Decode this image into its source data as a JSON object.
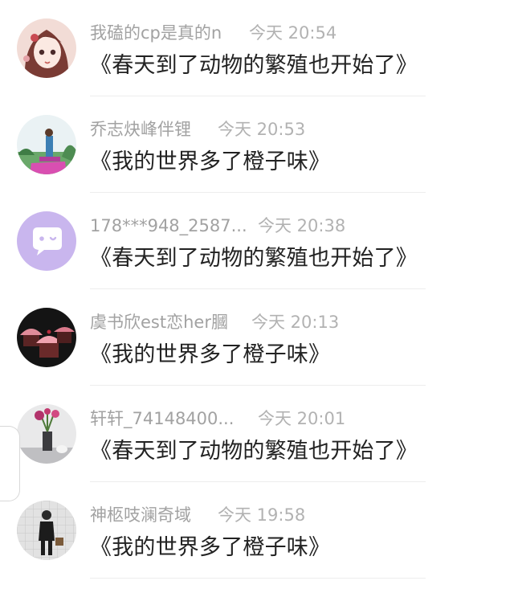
{
  "comments": [
    {
      "username": "我磕的cp是真的n",
      "time": "今天 20:54",
      "text": "《春天到了动物的繁殖也开始了》",
      "avatar_icon": "anime-girl-avatar"
    },
    {
      "username": "乔志炔峰伴锂",
      "time": "今天 20:53",
      "text": "《我的世界多了橙子味》",
      "avatar_icon": "outdoor-photo-avatar"
    },
    {
      "username": "178***948_2587...",
      "time": "今天 20:38",
      "text": "《春天到了动物的繁殖也开始了》",
      "avatar_icon": "default-chat-avatar"
    },
    {
      "username": "虞书欣est恋her膕",
      "time": "今天 20:13",
      "text": "《我的世界多了橙子味》",
      "avatar_icon": "cupcake-avatar"
    },
    {
      "username": "轩轩_74148400...",
      "time": "今天 20:01",
      "text": "《春天到了动物的繁殖也开始了》",
      "avatar_icon": "flower-vase-avatar"
    },
    {
      "username": "神柩吱澜奇域",
      "time": "今天 19:58",
      "text": "《我的世界多了橙子味》",
      "avatar_icon": "person-photo-avatar"
    }
  ],
  "colors": {
    "username": "#a2a2a2",
    "time": "#b2b2b2",
    "text": "#222222",
    "divider": "#ededed",
    "default_avatar_bg": "#c9b6ee"
  }
}
